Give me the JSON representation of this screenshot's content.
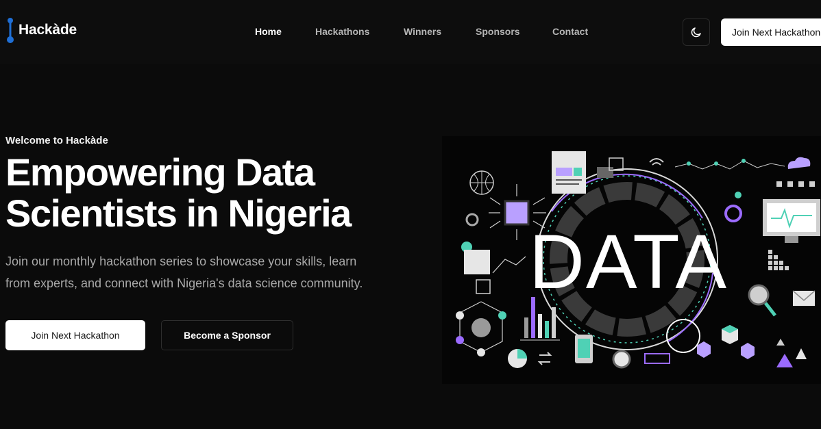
{
  "brand": {
    "name": "Hackàde"
  },
  "nav": {
    "items": [
      {
        "label": "Home",
        "active": true
      },
      {
        "label": "Hackathons",
        "active": false
      },
      {
        "label": "Winners",
        "active": false
      },
      {
        "label": "Sponsors",
        "active": false
      },
      {
        "label": "Contact",
        "active": false
      }
    ]
  },
  "header": {
    "theme_icon": "moon-icon",
    "cta_label": "Join Next Hackathon"
  },
  "hero": {
    "eyebrow": "Welcome to Hackàde",
    "headline_line1": "Empowering Data",
    "headline_line2": "Scientists in Nigeria",
    "subtext_line1": "Join our monthly hackathon series to showcase your skills, learn",
    "subtext_line2": "from experts, and connect with Nigeria's data science community.",
    "primary_cta": "Join Next Hackathon",
    "secondary_cta": "Become a Sponsor",
    "image_word": "DATA"
  },
  "colors": {
    "background": "#0b0b0b",
    "accent_purple": "#9b6bff",
    "accent_teal": "#4fd1b5",
    "logo_blue": "#1f6fd6"
  }
}
